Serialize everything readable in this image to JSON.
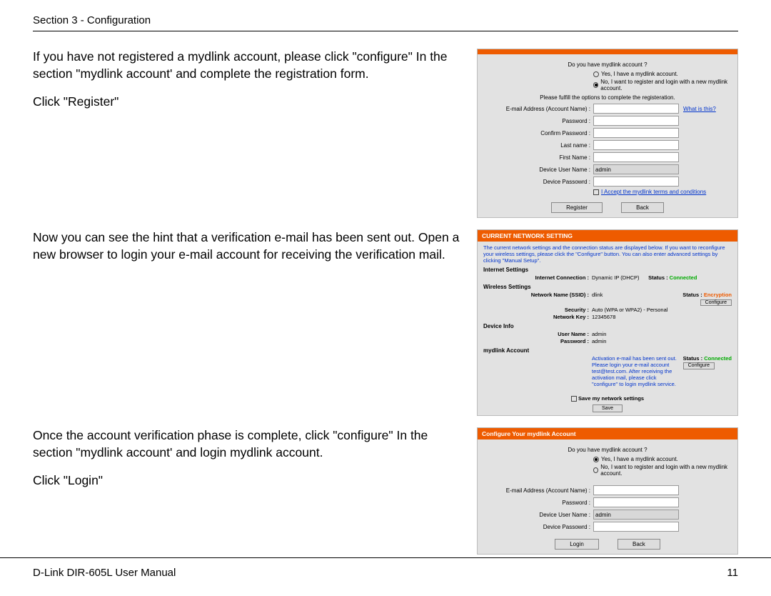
{
  "header": {
    "section_label": "Section 3 - Configuration"
  },
  "footer": {
    "manual": "D-Link DIR-605L User Manual",
    "page": "11"
  },
  "blocks": {
    "b1": {
      "p1": "If you have not registered a mydlink account, please click \"configure\" In the section \"mydlink account' and complete the registration form.",
      "p2": "Click \"Register\""
    },
    "b2": {
      "p1": "Now you can see the hint that a verification e-mail has been sent out. Open a new browser to login your e-mail account for receiving the verification mail."
    },
    "b3": {
      "p1": "Once the account verification phase is complete, click \"configure\" In the section \"mydlink account' and login mydlink account.",
      "p2": "Click \"Login\""
    }
  },
  "ss1": {
    "q": "Do you have mydlink account ?",
    "opt_yes": "Yes, I have a mydlink account.",
    "opt_no": "No, I want to register and login with a new mydlink account.",
    "fulfill": "Please fulfill the options to complete the registeration.",
    "labels": {
      "email": "E-mail Address (Account Name) :",
      "password": "Password :",
      "confirm": "Confirm Password :",
      "last": "Last name :",
      "first": "First Name :",
      "dev_user": "Device User Name :",
      "dev_pass": "Device Passowrd :"
    },
    "dev_user_val": "admin",
    "what_is": "What is this?",
    "terms": "I Accept the mydlink terms and conditions",
    "register": "Register",
    "back": "Back"
  },
  "ss2": {
    "title": "CURRENT NETWORK SETTING",
    "desc": "The current network settings and the connection status are displayed below. If you want to reconfigure your wireless settings, please click the \"Configure\" button. You can also enter advanced settings by clicking \"Manual Setup\".",
    "internet_h": "Internet Settings",
    "internet_conn_l": "Internet Connection :",
    "internet_conn_v": "Dynamic IP (DHCP)",
    "status_l": "Status :",
    "status_connected": "Connected",
    "wireless_h": "Wireless Settings",
    "ssid_l": "Network Name (SSID) :",
    "ssid_v": "dlink",
    "encryption": "Encryption",
    "configure": "Configure",
    "security_l": "Security :",
    "security_v": "Auto (WPA or WPA2) - Personal",
    "key_l": "Network Key :",
    "key_v": "12345678",
    "device_h": "Device Info",
    "user_l": "User Name :",
    "user_v": "admin",
    "pass_l": "Password :",
    "pass_v": "admin",
    "mydlink_h": "mydlink Account",
    "activation_msg": "Activation e-mail has been sent out. Please login your e-mail account test@test.com. After receiving the activation mail, please click \"configure\" to login mydlink service.",
    "save_l": "Save my network settings",
    "save_btn": "Save"
  },
  "ss3": {
    "title": "Configure Your mydlink Account",
    "q": "Do you have mydlink account ?",
    "opt_yes": "Yes, I have a mydlink account.",
    "opt_no": "No, I want to register and login with a new mydlink account.",
    "labels": {
      "email": "E-mail Address (Account Name) :",
      "password": "Password :",
      "dev_user": "Device User Name :",
      "dev_pass": "Device Passowrd :"
    },
    "dev_user_val": "admin",
    "login": "Login",
    "back": "Back"
  }
}
